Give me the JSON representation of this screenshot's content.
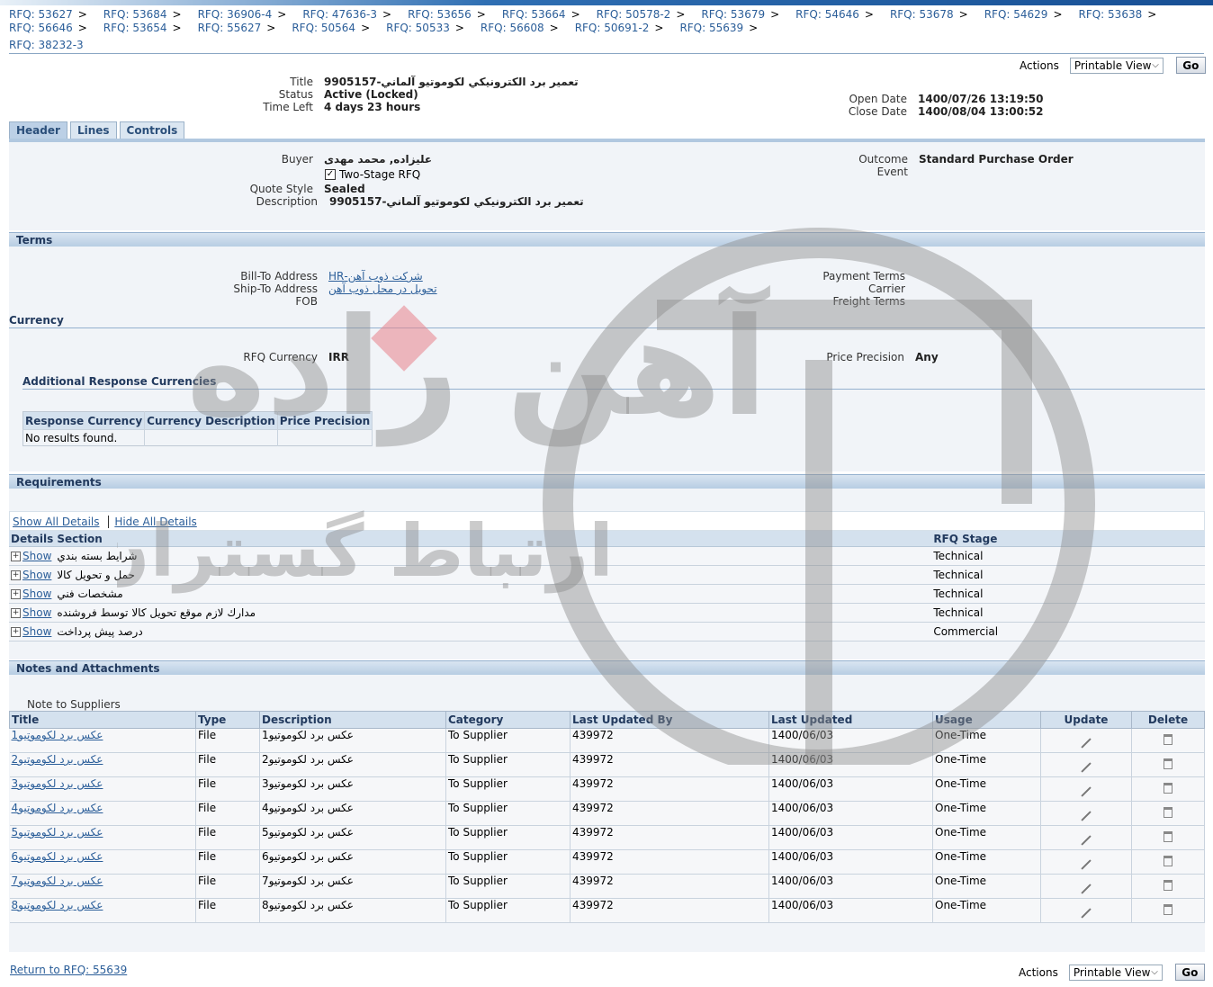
{
  "breadcrumbs": [
    "RFQ: 53627",
    "RFQ: 53684",
    "RFQ: 36906-4",
    "RFQ: 47636-3",
    "RFQ: 53656",
    "RFQ: 53664",
    "RFQ: 50578-2",
    "RFQ: 53679",
    "RFQ: 54646",
    "RFQ: 53678",
    "RFQ: 54629",
    "RFQ: 53638",
    "RFQ: 56646",
    "RFQ: 53654",
    "RFQ: 55627",
    "RFQ: 50564",
    "RFQ: 50533",
    "RFQ: 56608",
    "RFQ: 50691-2",
    "RFQ: 55639"
  ],
  "breadcrumb_sep": ">",
  "current_rfq": "RFQ: 38232-3",
  "actions": {
    "label": "Actions",
    "select_value": "Printable View",
    "go": "Go"
  },
  "summary": {
    "title_label": "Title",
    "title_value": "تعمیر برد الکترونیکي لکوموتیو آلماني-9905157",
    "status_label": "Status",
    "status_value": "Active (Locked)",
    "timeleft_label": "Time Left",
    "timeleft_value": "4 days 23 hours",
    "open_label": "Open Date",
    "open_value": "1400/07/26 13:19:50",
    "close_label": "Close Date",
    "close_value": "1400/08/04 13:00:52"
  },
  "tabs": [
    "Header",
    "Lines",
    "Controls"
  ],
  "header": {
    "buyer_label": "Buyer",
    "buyer_value": "عليزاده, محمد مهدی",
    "two_stage": "Two-Stage RFQ",
    "quote_style_label": "Quote Style",
    "quote_style_value": "Sealed",
    "description_label": "Description",
    "description_value": "تعمیر برد الکترونیکي لکوموتیو آلماني-9905157",
    "outcome_label": "Outcome",
    "outcome_value": "Standard Purchase Order",
    "event_label": "Event"
  },
  "terms": {
    "title": "Terms",
    "billto_label": "Bill-To Address",
    "billto_value": "شرکت ذوب آهن-HR",
    "shipto_label": "Ship-To Address",
    "shipto_value": "تحویل در محل ذوب آهن",
    "fob_label": "FOB",
    "payment_label": "Payment Terms",
    "carrier_label": "Carrier",
    "freight_label": "Freight Terms"
  },
  "currency": {
    "title": "Currency",
    "rfq_currency_label": "RFQ Currency",
    "rfq_currency_value": "IRR",
    "price_precision_label": "Price Precision",
    "price_precision_value": "Any",
    "additional_title": "Additional Response Currencies",
    "columns": [
      "Response Currency",
      "Currency Description",
      "Price Precision"
    ],
    "empty": "No results found."
  },
  "requirements": {
    "title": "Requirements",
    "show_all": "Show All Details",
    "hide_all": "Hide All Details",
    "columns": [
      "Details",
      "Section",
      "RFQ Stage"
    ],
    "show_label": "Show",
    "rows": [
      {
        "section": "شرايط بسته بندي",
        "stage": "Technical"
      },
      {
        "section": "حمل و تحويل كالا",
        "stage": "Technical"
      },
      {
        "section": "مشخصات فني",
        "stage": "Technical"
      },
      {
        "section": "مدارك لازم موقع تحويل كالا توسط فروشنده",
        "stage": "Technical"
      },
      {
        "section": "درصد پيش پرداخت",
        "stage": "Commercial"
      }
    ]
  },
  "notes": {
    "title": "Notes and Attachments",
    "note_label": "Note to Suppliers",
    "columns": [
      "Title",
      "Type",
      "Description",
      "Category",
      "Last Updated By",
      "Last Updated",
      "Usage",
      "Update",
      "Delete"
    ],
    "rows": [
      {
        "title": "عکس برد لکوموتیو1",
        "type": "File",
        "description": "عکس برد لکوموتیو1",
        "category": "To Supplier",
        "by": "439972",
        "date": "1400/06/03",
        "usage": "One-Time"
      },
      {
        "title": "عکس برد لکوموتیو2",
        "type": "File",
        "description": "عکس برد لکوموتیو2",
        "category": "To Supplier",
        "by": "439972",
        "date": "1400/06/03",
        "usage": "One-Time"
      },
      {
        "title": "عکس برد لکوموتیو3",
        "type": "File",
        "description": "عکس برد لکوموتیو3",
        "category": "To Supplier",
        "by": "439972",
        "date": "1400/06/03",
        "usage": "One-Time"
      },
      {
        "title": "عکس برد لکوموتیو4",
        "type": "File",
        "description": "عکس برد لکوموتیو4",
        "category": "To Supplier",
        "by": "439972",
        "date": "1400/06/03",
        "usage": "One-Time"
      },
      {
        "title": "عکس برد لکوموتیو5",
        "type": "File",
        "description": "عکس برد لکوموتیو5",
        "category": "To Supplier",
        "by": "439972",
        "date": "1400/06/03",
        "usage": "One-Time"
      },
      {
        "title": "عکس برد لکوموتیو6",
        "type": "File",
        "description": "عکس برد لکوموتیو6",
        "category": "To Supplier",
        "by": "439972",
        "date": "1400/06/03",
        "usage": "One-Time"
      },
      {
        "title": "عکس برد لکوموتیو7",
        "type": "File",
        "description": "عکس برد لکوموتیو7",
        "category": "To Supplier",
        "by": "439972",
        "date": "1400/06/03",
        "usage": "One-Time"
      },
      {
        "title": "عکس برد لکوموتیو8",
        "type": "File",
        "description": "عکس برد لکوموتیو8",
        "category": "To Supplier",
        "by": "439972",
        "date": "1400/06/03",
        "usage": "One-Time"
      }
    ]
  },
  "return_link": "Return to RFQ: 55639",
  "watermark_text_1": "آهن راده",
  "watermark_text_2": "ارتباط گستران"
}
